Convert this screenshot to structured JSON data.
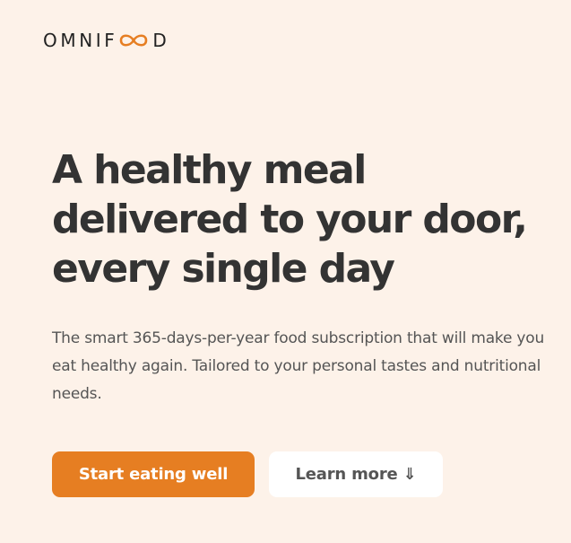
{
  "brand": {
    "prefix": "OMNIF",
    "suffix": "D",
    "logo_icon": "infinity-icon",
    "accent_color": "#e67e22"
  },
  "hero": {
    "title": "A healthy meal\ndelivered to your door,\nevery single day",
    "description": "The smart 365-days-per-year food subscription that will make you eat healthy again. Tailored to your personal tastes and nutritional needs.",
    "primary_cta": "Start eating well",
    "secondary_cta": "Learn more ⇓"
  },
  "colors": {
    "background": "#fdf2e9",
    "primary_button": "#e67e22",
    "secondary_button": "#ffffff",
    "heading_text": "#333333",
    "body_text": "#555555"
  }
}
